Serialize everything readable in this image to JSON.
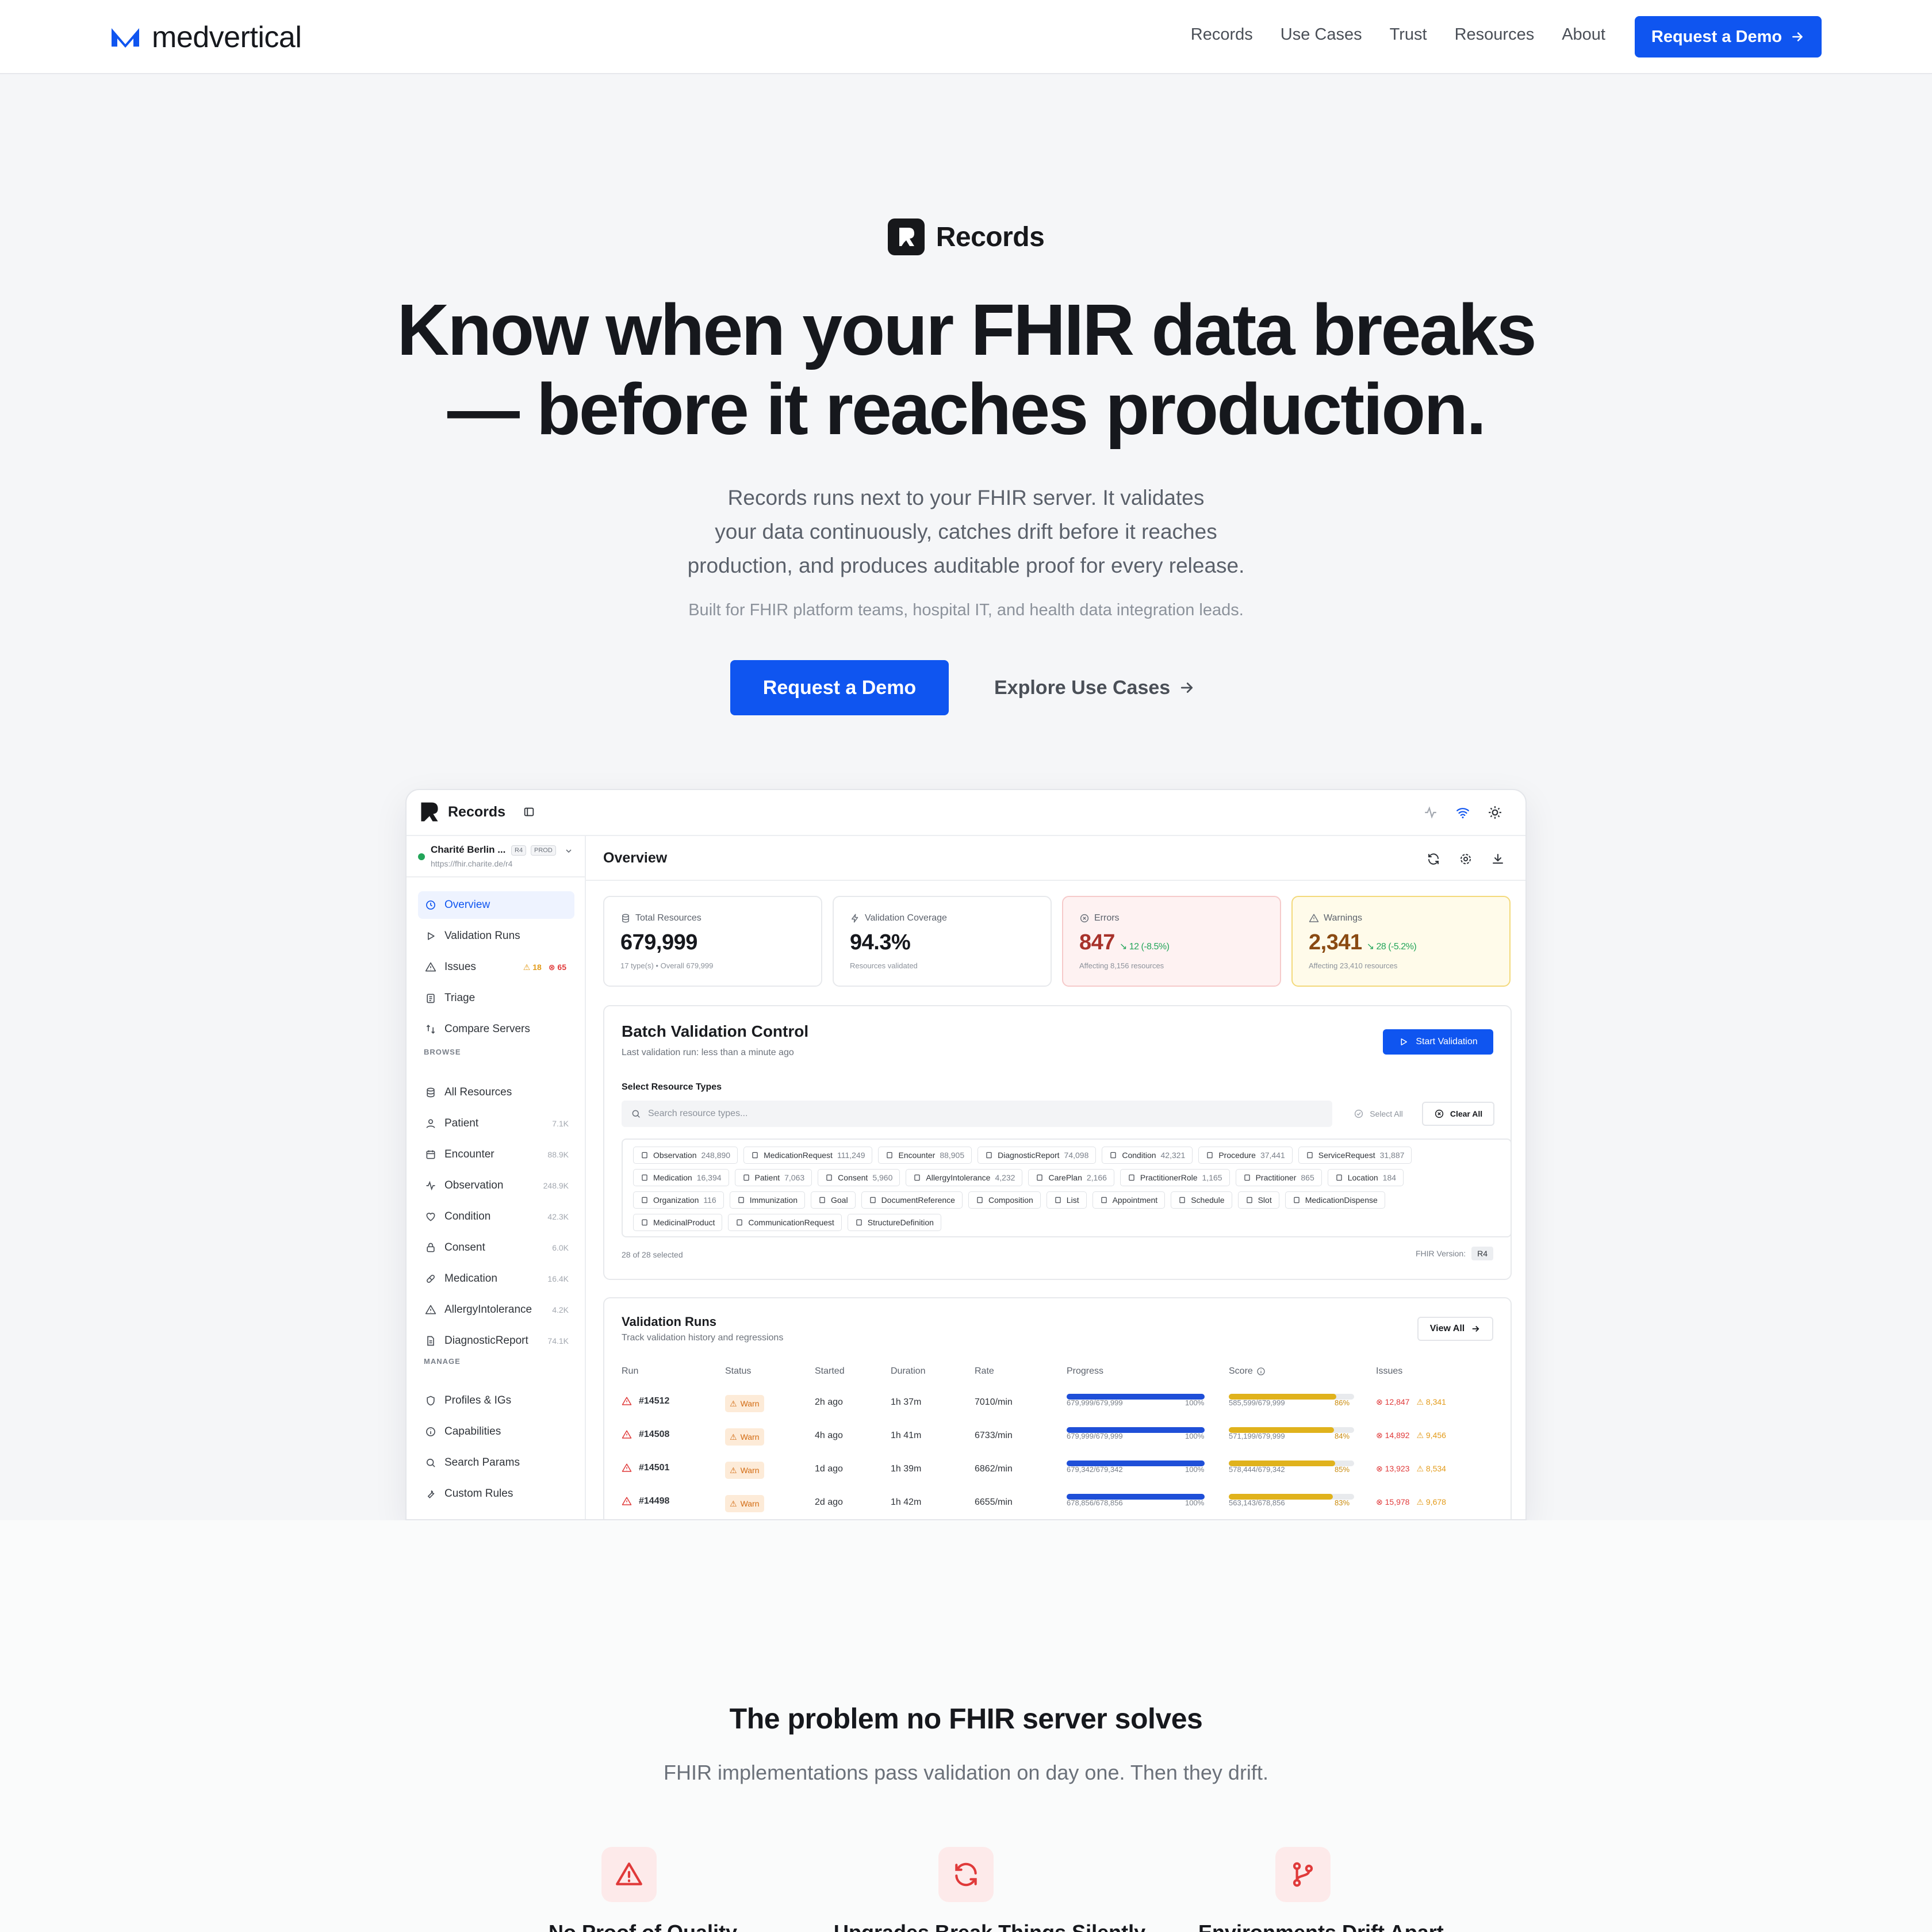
{
  "nav": {
    "brand": "medvertical",
    "links": [
      "Records",
      "Use Cases",
      "Trust",
      "Resources",
      "About"
    ],
    "cta": "Request a Demo",
    "accent": "#0f55f0"
  },
  "hero": {
    "product": "Records",
    "title_line1": "Know when your FHIR data breaks",
    "title_line2": "— before it reaches production.",
    "sub_line1": "Records runs next to your FHIR server. It validates",
    "sub_line2": "your data continuously, catches drift before it reaches",
    "sub_line3": "production, and produces auditable proof for every release.",
    "audience": "Built for FHIR platform teams, hospital IT, and health data integration leads.",
    "cta_primary": "Request a Demo",
    "cta_secondary": "Explore Use Cases"
  },
  "app": {
    "brand": "Records",
    "server": {
      "name": "Charité Berlin ...",
      "version": "R4",
      "env": "PROD",
      "url": "https://fhir.charite.de/r4",
      "status_color": "#22a559"
    },
    "sidebar": {
      "top": [
        {
          "label": "Overview",
          "icon": "clock-icon",
          "active": true
        },
        {
          "label": "Validation Runs",
          "icon": "play-icon"
        },
        {
          "label": "Issues",
          "icon": "warning-icon",
          "warn": "18",
          "err": "65"
        },
        {
          "label": "Triage",
          "icon": "clipboard-icon"
        },
        {
          "label": "Compare Servers",
          "icon": "compare-icon"
        }
      ],
      "browse_label": "BROWSE",
      "browse": [
        {
          "label": "All Resources",
          "icon": "database-icon",
          "count": ""
        },
        {
          "label": "Patient",
          "icon": "user-icon",
          "count": "7.1K"
        },
        {
          "label": "Encounter",
          "icon": "calendar-icon",
          "count": "88.9K"
        },
        {
          "label": "Observation",
          "icon": "pulse-icon",
          "count": "248.9K"
        },
        {
          "label": "Condition",
          "icon": "heart-icon",
          "count": "42.3K"
        },
        {
          "label": "Consent",
          "icon": "lock-icon",
          "count": "6.0K"
        },
        {
          "label": "Medication",
          "icon": "pill-icon",
          "count": "16.4K"
        },
        {
          "label": "AllergyIntolerance",
          "icon": "warning-icon",
          "count": "4.2K"
        },
        {
          "label": "DiagnosticReport",
          "icon": "file-icon",
          "count": "74.1K"
        }
      ],
      "manage_label": "MANAGE",
      "manage": [
        {
          "label": "Profiles & IGs",
          "icon": "shield-icon"
        },
        {
          "label": "Capabilities",
          "icon": "info-icon"
        },
        {
          "label": "Search Params",
          "icon": "search-icon"
        },
        {
          "label": "Custom Rules",
          "icon": "wrench-icon"
        }
      ]
    },
    "main_title": "Overview",
    "stats": [
      {
        "label": "Total Resources",
        "icon": "database-icon",
        "value": "679,999",
        "delta": "",
        "sub": "17 type(s) • Overall 679,999",
        "kind": "normal"
      },
      {
        "label": "Validation Coverage",
        "icon": "bolt-icon",
        "value": "94.3%",
        "delta": "",
        "sub": "Resources validated",
        "kind": "normal"
      },
      {
        "label": "Errors",
        "icon": "error-icon",
        "value": "847",
        "delta": "↘ 12 (-8.5%)",
        "sub": "Affecting 8,156 resources",
        "kind": "err"
      },
      {
        "label": "Warnings",
        "icon": "warning-icon",
        "value": "2,341",
        "delta": "↘ 28 (-5.2%)",
        "sub": "Affecting 23,410 resources",
        "kind": "warn"
      }
    ],
    "batch": {
      "title": "Batch Validation Control",
      "sub": "Last validation run: less than a minute ago",
      "start": "Start Validation",
      "select_label": "Select Resource Types",
      "search_placeholder": "Search resource types...",
      "select_all": "Select All",
      "clear_all": "Clear All",
      "chip_rows": [
        [
          [
            "Observation",
            "248,890"
          ],
          [
            "MedicationRequest",
            "111,249"
          ],
          [
            "Encounter",
            "88,905"
          ],
          [
            "DiagnosticReport",
            "74,098"
          ],
          [
            "Condition",
            "42,321"
          ],
          [
            "Procedure",
            "37,441"
          ],
          [
            "ServiceRequest",
            "31,887"
          ]
        ],
        [
          [
            "Medication",
            "16,394"
          ],
          [
            "Patient",
            "7,063"
          ],
          [
            "Consent",
            "5,960"
          ],
          [
            "AllergyIntolerance",
            "4,232"
          ],
          [
            "CarePlan",
            "2,166"
          ],
          [
            "PractitionerRole",
            "1,165"
          ],
          [
            "Practitioner",
            "865"
          ],
          [
            "Location",
            "184"
          ]
        ],
        [
          [
            "Organization",
            "116"
          ],
          [
            "Immunization",
            ""
          ],
          [
            "Goal",
            ""
          ],
          [
            "DocumentReference",
            ""
          ],
          [
            "Composition",
            ""
          ],
          [
            "List",
            ""
          ],
          [
            "Appointment",
            ""
          ],
          [
            "Schedule",
            ""
          ],
          [
            "Slot",
            ""
          ],
          [
            "MedicationDispense",
            ""
          ]
        ],
        [
          [
            "MedicinalProduct",
            ""
          ],
          [
            "CommunicationRequest",
            ""
          ],
          [
            "StructureDefinition",
            ""
          ]
        ]
      ],
      "selected": "28 of 28 selected",
      "fhir_label": "FHIR Version:",
      "fhir_version": "R4"
    },
    "runs": {
      "title": "Validation Runs",
      "sub": "Track validation history and regressions",
      "view_all": "View All",
      "headers": [
        "Run",
        "Status",
        "Started",
        "Duration",
        "Rate",
        "Progress",
        "Score",
        "Issues"
      ],
      "rows": [
        {
          "run": "#14512",
          "status": "Warn",
          "started": "2h ago",
          "duration": "1h 37m",
          "rate": "7010/min",
          "progress_label": "679,999/679,999",
          "progress": 100,
          "progress_pct": "100%",
          "score_label": "585,599/679,999",
          "score": 86,
          "score_pct": "86%",
          "errors": "12,847",
          "warnings": "8,341"
        },
        {
          "run": "#14508",
          "status": "Warn",
          "started": "4h ago",
          "duration": "1h 41m",
          "rate": "6733/min",
          "progress_label": "679,999/679,999",
          "progress": 100,
          "progress_pct": "100%",
          "score_label": "571,199/679,999",
          "score": 84,
          "score_pct": "84%",
          "errors": "14,892",
          "warnings": "9,456"
        },
        {
          "run": "#14501",
          "status": "Warn",
          "started": "1d ago",
          "duration": "1h 39m",
          "rate": "6862/min",
          "progress_label": "679,342/679,342",
          "progress": 100,
          "progress_pct": "100%",
          "score_label": "578,444/679,342",
          "score": 85,
          "score_pct": "85%",
          "errors": "13,923",
          "warnings": "8,534"
        },
        {
          "run": "#14498",
          "status": "Warn",
          "started": "2d ago",
          "duration": "1h 42m",
          "rate": "6655/min",
          "progress_label": "678,856/678,856",
          "progress": 100,
          "progress_pct": "100%",
          "score_label": "563,143/678,856",
          "score": 83,
          "score_pct": "83%",
          "errors": "15,978",
          "warnings": "9,678"
        }
      ],
      "progress_color": "#1f4fd8",
      "score_color": "#e0b21c"
    }
  },
  "problem": {
    "title": "The problem no FHIR server solves",
    "sub": "FHIR implementations pass validation on day one. Then they drift.",
    "items": [
      {
        "icon": "warning-icon",
        "title": "No Proof of Quality"
      },
      {
        "icon": "refresh-icon",
        "title": "Upgrades Break Things Silently"
      },
      {
        "icon": "branch-icon",
        "title": "Environments Drift Apart"
      }
    ]
  }
}
